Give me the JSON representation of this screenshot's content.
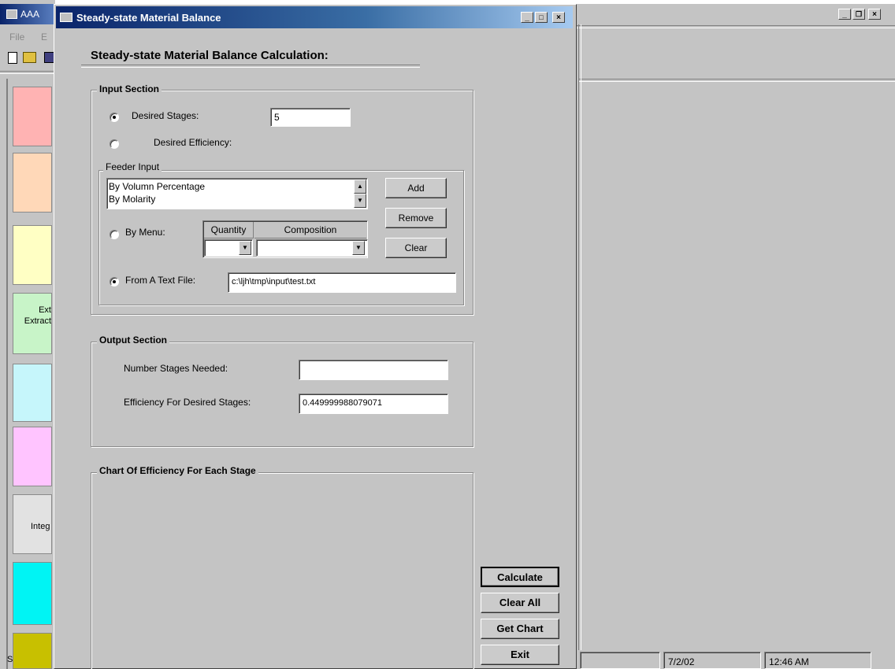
{
  "bg_app": {
    "title_partial": "AAA",
    "menu": [
      "File",
      "E"
    ],
    "swatch_labels": [
      "Ext\nExtract",
      "Integ"
    ],
    "left_status_char": "S"
  },
  "right_window": {
    "status": {
      "date": "7/2/02",
      "time": "12:46 AM"
    }
  },
  "dialog": {
    "title": "Steady-state Material Balance",
    "heading": "Steady-state Material Balance Calculation:",
    "input_section": {
      "title": "Input Section",
      "desired_stages_label": "Desired Stages:",
      "desired_stages_value": "5",
      "desired_efficiency_label": "Desired Efficiency:",
      "feeder_input": {
        "title": "Feeder Input",
        "list_items": [
          "By Volumn Percentage",
          "By Molarity"
        ],
        "by_menu_label": "By Menu:",
        "quantity_header": "Quantity",
        "composition_header": "Composition",
        "quantity_value": "",
        "composition_value": "",
        "from_text_file_label": "From  A Text File:",
        "text_file_path": "c:\\ljh\\tmp\\input\\test.txt",
        "add_label": "Add",
        "remove_label": "Remove",
        "clear_label": "Clear"
      }
    },
    "output_section": {
      "title": "Output Section",
      "stages_needed_label": "Number Stages Needed:",
      "stages_needed_value": "",
      "efficiency_label": "Efficiency For Desired Stages:",
      "efficiency_value": "0.449999988079071"
    },
    "chart_section": {
      "title": "Chart Of Efficiency For Each Stage"
    },
    "buttons": {
      "calculate": "Calculate",
      "clear_all": "Clear All",
      "get_chart": "Get Chart",
      "exit": "Exit"
    }
  },
  "colors": {
    "title_bar_start": "#0a246a",
    "title_bar_end": "#a6caf0",
    "face": "#c4c4c4",
    "swatches": [
      "#ffb3b3",
      "#ffd8b8",
      "#ffffc4",
      "#c8f4c8",
      "#c6f6fb",
      "#ffc4ff",
      "#e2e2e2",
      "#00f4f4",
      "#c8c000"
    ]
  }
}
